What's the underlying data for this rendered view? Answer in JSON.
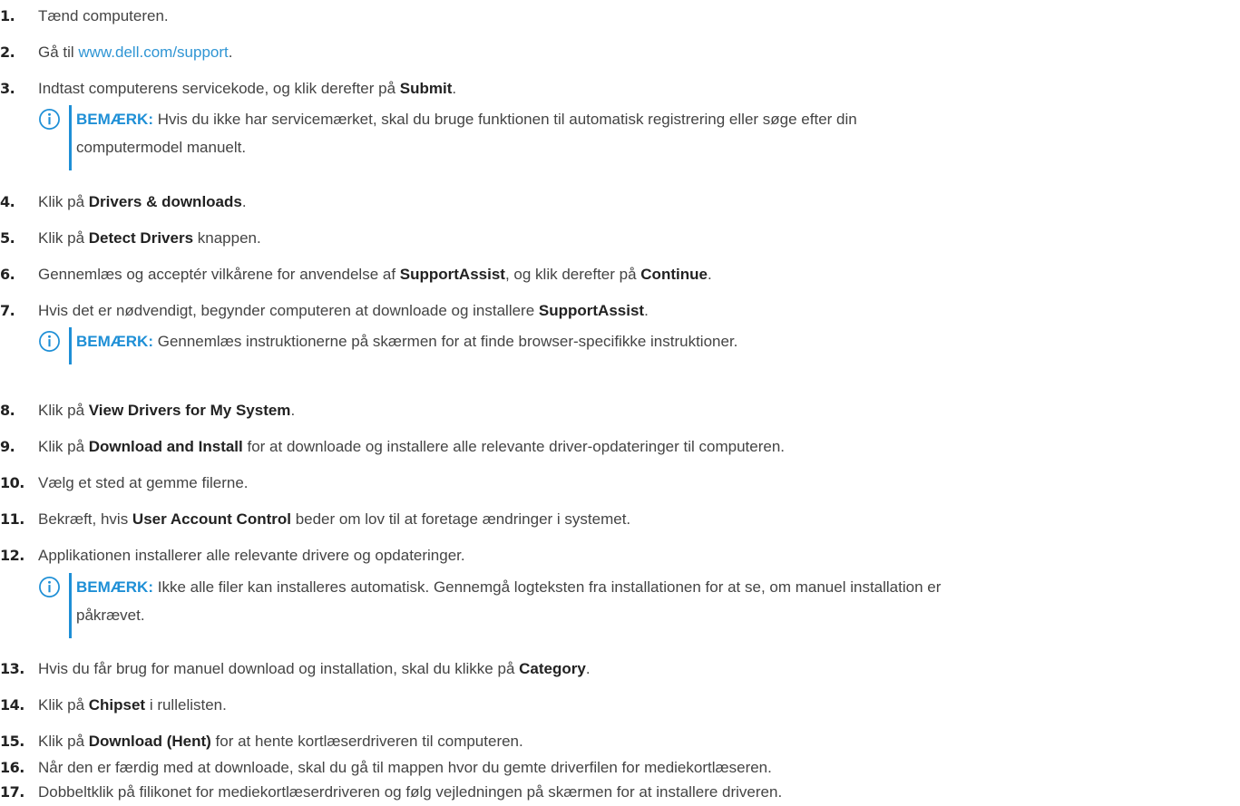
{
  "steps": [
    {
      "num": "1.",
      "pre": "Tænd computeren."
    },
    {
      "num": "2.",
      "pre": "Gå til ",
      "link": "www.dell.com/support",
      "post": "."
    },
    {
      "num": "3.",
      "pre": "Indtast computerens servicekode, og klik derefter på ",
      "bold": "Submit",
      "post": "."
    },
    {
      "num": "4.",
      "pre": "Klik på ",
      "bold": "Drivers & downloads",
      "post": "."
    },
    {
      "num": "5.",
      "pre": "Klik på ",
      "bold": "Detect Drivers",
      "post": " knappen."
    },
    {
      "num": "6.",
      "pre": "Gennemlæs og acceptér vilkårene for anvendelse af ",
      "bold": "SupportAssist",
      "mid": ", og klik derefter på ",
      "bold2": "Continue",
      "post": "."
    },
    {
      "num": "7.",
      "pre": "Hvis det er nødvendigt, begynder computeren at downloade og installere ",
      "bold": "SupportAssist",
      "post": "."
    },
    {
      "num": "8.",
      "pre": "Klik på ",
      "bold": "View Drivers for My System",
      "post": "."
    },
    {
      "num": "9.",
      "pre": "Klik på ",
      "bold": "Download and Install",
      "post": " for at downloade og installere alle relevante driver-opdateringer til computeren."
    },
    {
      "num": "10.",
      "pre": "Vælg et sted at gemme filerne."
    },
    {
      "num": "11.",
      "pre": "Bekræft, hvis ",
      "bold": "User Account Control",
      "post": " beder om lov til at foretage ændringer i systemet."
    },
    {
      "num": "12.",
      "pre": "Applikationen installerer alle relevante drivere og opdateringer."
    },
    {
      "num": "13.",
      "pre": "Hvis du får brug for manuel download og installation, skal du klikke på ",
      "bold": "Category",
      "post": "."
    },
    {
      "num": "14.",
      "pre": "Klik på ",
      "bold": "Chipset",
      "post": " i rullelisten."
    },
    {
      "num": "15.",
      "pre": "Klik på ",
      "bold": "Download (Hent)",
      "post": " for at hente kortlæserdriveren til computeren."
    },
    {
      "num": "16.",
      "pre": "Når den er færdig med at downloade, skal du gå til mappen hvor du gemte driverfilen for mediekortlæseren."
    },
    {
      "num": "17.",
      "pre": "Dobbeltklik på filikonet for mediekortlæserdriveren og følg vejledningen på skærmen for at installere driveren."
    }
  ],
  "notes": [
    {
      "label": "BEMÆRK:",
      "line1": " Hvis du ikke har servicemærket, skal du bruge funktionen til automatisk registrering eller søge efter din",
      "line2": "computermodel manuelt."
    },
    {
      "label": "BEMÆRK:",
      "line1": " Gennemlæs instruktionerne på skærmen for at finde browser-specifikke instruktioner."
    },
    {
      "label": "BEMÆRK:",
      "line1": " Ikke alle filer kan installeres automatisk. Gennemgå logteksten fra installationen for at se, om manuel installation er",
      "line2": "påkrævet."
    }
  ],
  "icons": {
    "note_icon": "info-circle-icon",
    "accent_color": "#1e8fd6",
    "link_color": "#2f95d4"
  }
}
